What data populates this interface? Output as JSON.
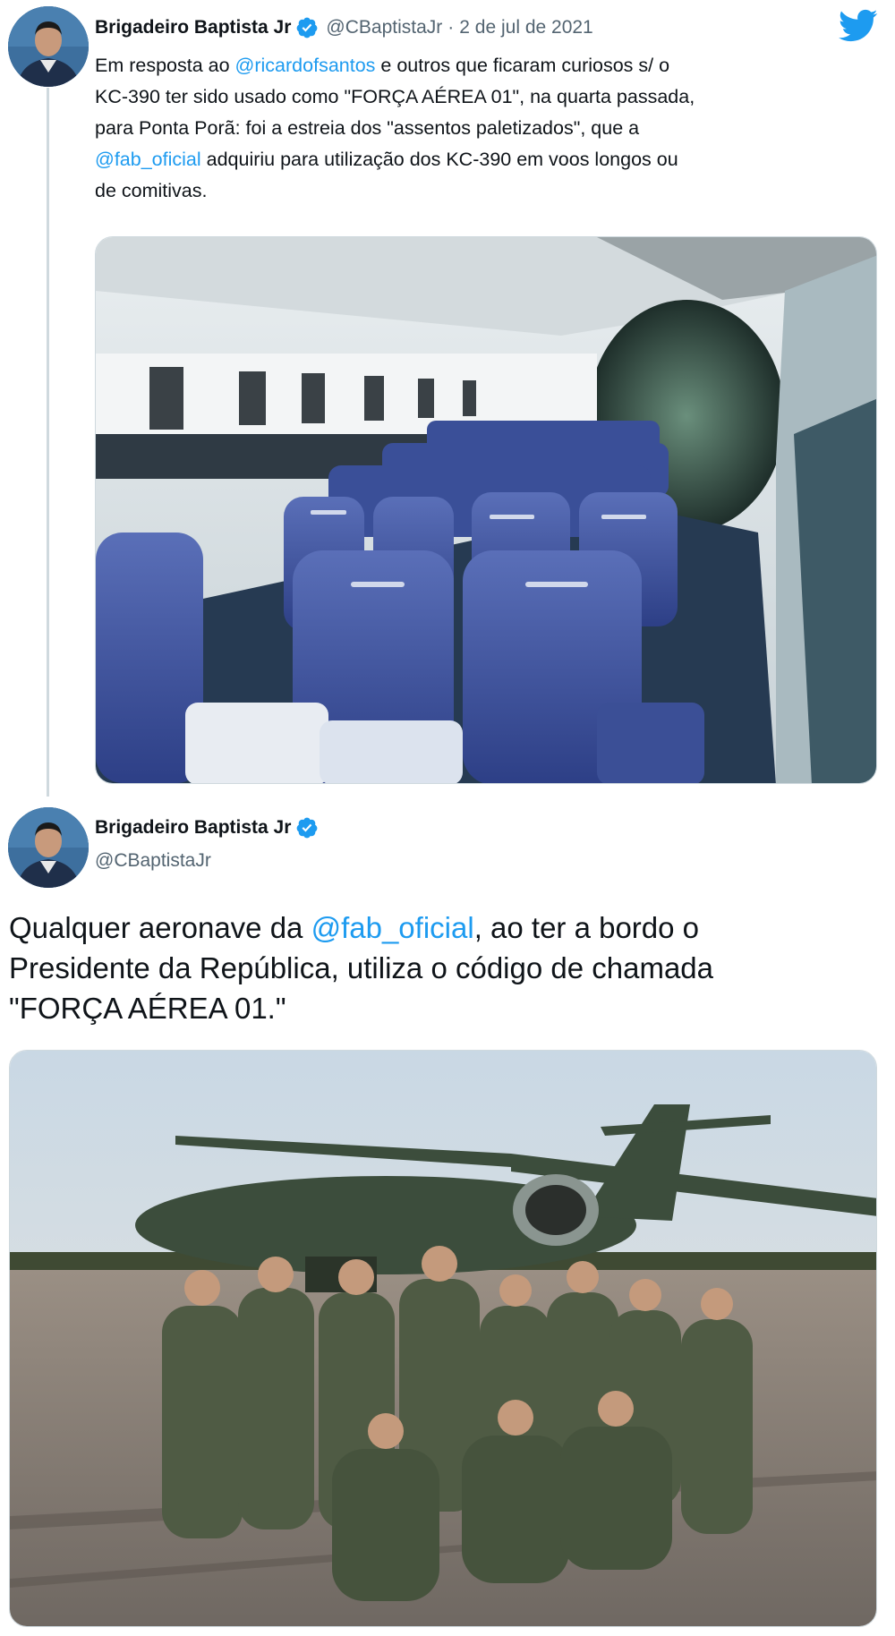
{
  "tweet": {
    "author_name": "Brigadeiro Baptista Jr",
    "handle": "@CBaptistaJr",
    "separator": "·",
    "date": "2 de jul de 2021",
    "lines": [
      [
        {
          "t": "Em resposta ao "
        },
        {
          "t": "@ricardofsantos",
          "m": true
        },
        {
          "t": " e outros que ficaram curiosos s/ o"
        }
      ],
      [
        {
          "t": "KC-390 ter sido usado como \"FORÇA AÉREA 01\", na quarta passada,"
        }
      ],
      [
        {
          "t": "para Ponta Porã: foi a estreia dos \"assentos paletizados\", que a"
        }
      ],
      [
        {
          "t": "@fab_oficial",
          "m": true
        },
        {
          "t": " adquiriu para utilização dos KC-390 em  voos longos ou"
        }
      ],
      [
        {
          "t": "de comitivas."
        }
      ]
    ]
  },
  "quoted": {
    "author_name": "Brigadeiro Baptista Jr",
    "handle": "@CBaptistaJr",
    "lines": [
      [
        {
          "t": "Qualquer aeronave da "
        },
        {
          "t": "@fab_oficial",
          "m": true
        },
        {
          "t": ", ao ter a bordo o"
        }
      ],
      [
        {
          "t": "Presidente da República, utiliza o código de chamada"
        }
      ],
      [
        {
          "t": "\"FORÇA AÉREA 01.\""
        }
      ]
    ]
  },
  "icons": {
    "brand": "twitter-bird-icon",
    "verified": "verified-badge-icon"
  },
  "colors": {
    "link": "#1d9bf0",
    "secondary_text": "#536471",
    "verified": "#1d9bf0",
    "brand": "#1d9bf0"
  }
}
